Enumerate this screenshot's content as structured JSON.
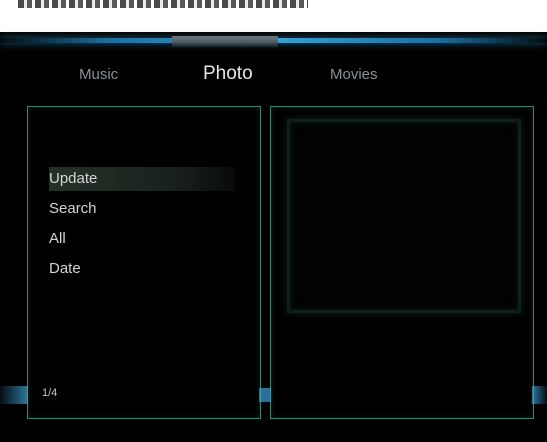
{
  "tabs": [
    {
      "label": "Music",
      "active": false
    },
    {
      "label": "Photo",
      "active": true
    },
    {
      "label": "Movies",
      "active": false
    }
  ],
  "menu": {
    "items": [
      {
        "label": "Update",
        "selected": true
      },
      {
        "label": "Search",
        "selected": false
      },
      {
        "label": "All",
        "selected": false
      },
      {
        "label": "Date",
        "selected": false
      }
    ]
  },
  "pagination": {
    "label": "1/4"
  },
  "colors": {
    "background": "#000000",
    "panel_border": "#3f7f76",
    "accent_glow": "#3a9fd0",
    "text_active": "#e6e6e6",
    "text_inactive": "#8a8f96",
    "menu_text": "#d4d4d4"
  }
}
